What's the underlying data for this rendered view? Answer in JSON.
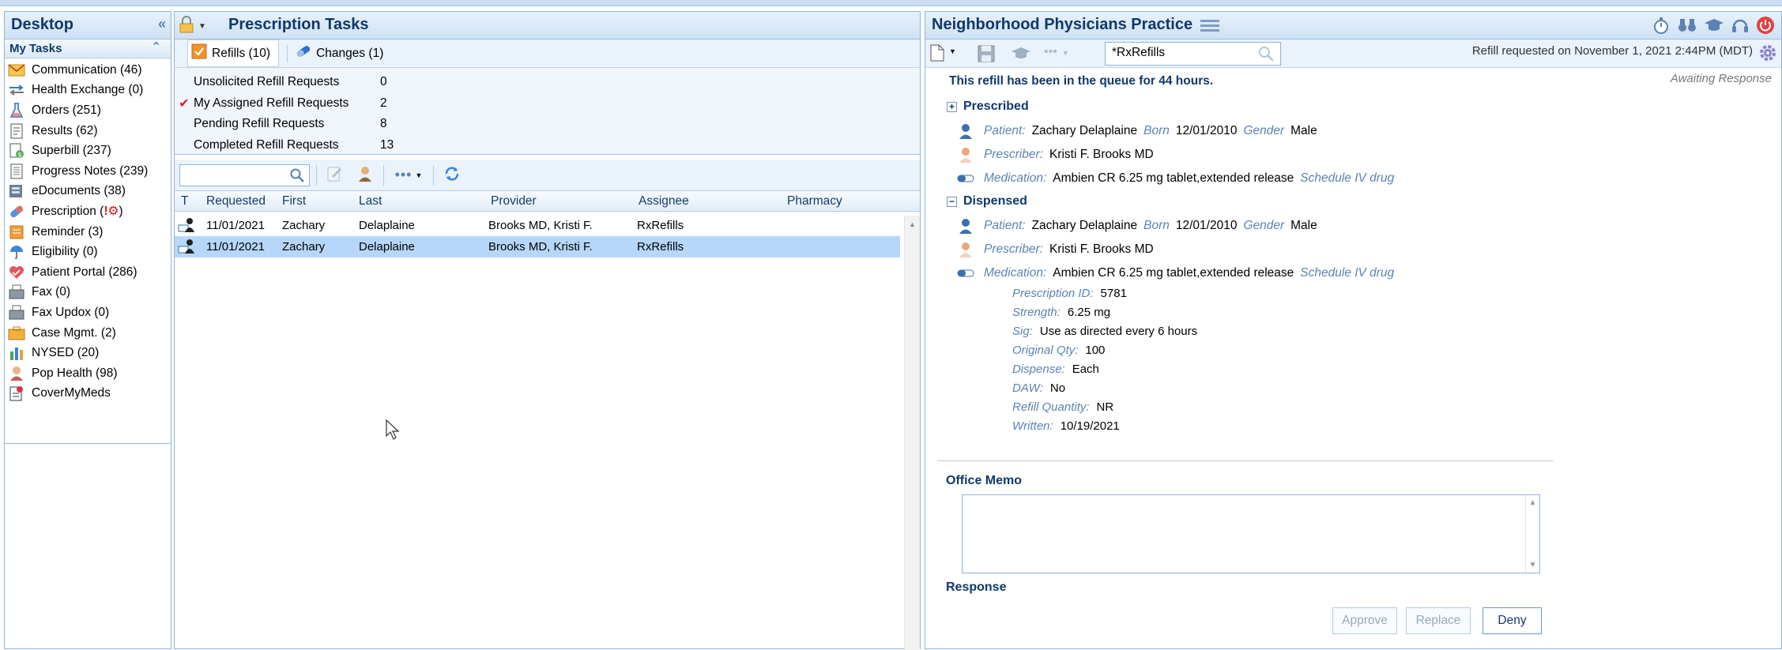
{
  "desktop": {
    "title": "Desktop",
    "my_tasks_label": "My Tasks",
    "items": [
      {
        "icon": "envelope-icon",
        "label": "Communication (46)"
      },
      {
        "icon": "arrows-icon",
        "label": "Health Exchange (0)"
      },
      {
        "icon": "flask-icon",
        "label": "Orders (251)"
      },
      {
        "icon": "document-icon",
        "label": "Results (62)"
      },
      {
        "icon": "bill-icon",
        "label": "Superbill (237)"
      },
      {
        "icon": "notes-icon",
        "label": "Progress Notes (239)"
      },
      {
        "icon": "edocuments-icon",
        "label": "eDocuments (38)"
      },
      {
        "icon": "pill-icon",
        "label": "Prescription (",
        "alert": "!",
        "gear": "⚙",
        "close": ")"
      },
      {
        "icon": "reminder-icon",
        "label": "Reminder (3)"
      },
      {
        "icon": "umbrella-icon",
        "label": "Eligibility (0)"
      },
      {
        "icon": "heart-icon",
        "label": "Patient Portal (286)"
      },
      {
        "icon": "fax-icon",
        "label": "Fax (0)"
      },
      {
        "icon": "fax-updox-icon",
        "label": "Fax Updox (0)"
      },
      {
        "icon": "briefcase-icon",
        "label": "Case Mgmt. (2)"
      },
      {
        "icon": "bar-chart-icon",
        "label": "NYSED (20)"
      },
      {
        "icon": "population-icon",
        "label": "Pop Health (98)"
      },
      {
        "icon": "covermymeds-icon",
        "label": "CoverMyMeds"
      }
    ]
  },
  "prescription_tasks": {
    "title": "Prescription Tasks",
    "tabs": [
      {
        "label": "Refills (10)"
      },
      {
        "label": "Changes (1)"
      }
    ],
    "summary": [
      {
        "label": "Unsolicited Refill Requests",
        "count": "0",
        "checked": ""
      },
      {
        "label": "My Assigned Refill Requests",
        "count": "2",
        "checked": "✔"
      },
      {
        "label": "Pending Refill Requests",
        "count": "8",
        "checked": ""
      },
      {
        "label": "Completed Refill Requests",
        "count": "13",
        "checked": ""
      }
    ],
    "columns": {
      "t": "T",
      "requested": "Requested",
      "first": "First",
      "last": "Last",
      "provider": "Provider",
      "assignee": "Assignee",
      "pharmacy": "Pharmacy"
    },
    "rows": [
      {
        "requested": "11/01/2021",
        "first": "Zachary",
        "last": "Delaplaine",
        "provider": "Brooks MD, Kristi F.",
        "assignee": "RxRefills",
        "pharmacy": ""
      },
      {
        "requested": "11/01/2021",
        "first": "Zachary",
        "last": "Delaplaine",
        "provider": "Brooks MD, Kristi F.",
        "assignee": "RxRefills",
        "pharmacy": ""
      }
    ]
  },
  "practice": {
    "title": "Neighborhood Physicians Practice",
    "search_value": "*RxRefills",
    "request_info": "Refill requested on November 1, 2021 2:44PM (MDT)",
    "queue_msg": "This refill has been in the queue for 44 hours.",
    "status": "Awaiting Response",
    "labels": {
      "patient": "Patient:",
      "born": "Born",
      "gender": "Gender",
      "prescriber": "Prescriber:",
      "medication": "Medication:"
    },
    "prescribed": {
      "title": "Prescribed",
      "toggle": "+",
      "patient": "Zachary Delaplaine",
      "born": "12/01/2010",
      "gender": "Male",
      "prescriber": "Kristi F. Brooks MD",
      "medication": "Ambien CR 6.25 mg tablet,extended release",
      "schedule": "Schedule IV drug"
    },
    "dispensed": {
      "title": "Dispensed",
      "toggle": "−",
      "patient": "Zachary Delaplaine",
      "born": "12/01/2010",
      "gender": "Male",
      "prescriber": "Kristi F. Brooks MD",
      "medication": "Ambien CR 6.25 mg tablet,extended release",
      "schedule": "Schedule IV drug",
      "details": [
        {
          "key": "Prescription ID:",
          "value": "5781"
        },
        {
          "key": "Strength:",
          "value": "6.25 mg"
        },
        {
          "key": "Sig:",
          "value": "Use as directed every 6 hours"
        },
        {
          "key": "Original Qty:",
          "value": "100"
        },
        {
          "key": "Dispense:",
          "value": "Each"
        },
        {
          "key": "DAW:",
          "value": "No"
        },
        {
          "key": "Refill Quantity:",
          "value": "NR"
        },
        {
          "key": "Written:",
          "value": "10/19/2021"
        }
      ]
    },
    "office_memo_label": "Office Memo",
    "response_label": "Response",
    "buttons": {
      "approve": "Approve",
      "replace": "Replace",
      "deny": "Deny"
    }
  }
}
